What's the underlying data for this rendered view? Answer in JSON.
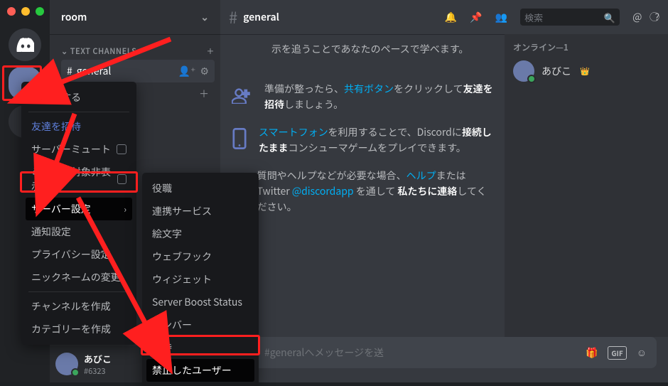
{
  "server": {
    "name": "room"
  },
  "channels": {
    "group_label": "TEXT CHANNELS",
    "items": [
      {
        "name": "general"
      }
    ]
  },
  "user_panel": {
    "name": "あびこ",
    "tag": "#6323"
  },
  "topbar": {
    "channel": "general",
    "search_placeholder": "検索"
  },
  "messages": {
    "m0": {
      "prefix": "示を追うことであなたのペースで学べます。"
    },
    "m1": {
      "prefix": "準備が整ったら、",
      "link": "共有ボタン",
      "suffix_bold": "友達を招待",
      "mid": "をクリックして",
      "tail": "しましょう。"
    },
    "m2": {
      "link": "スマートフォン",
      "mid": "を利用することで、Discordに",
      "bold": "接続したまま",
      "tail": "コンシューマゲームをプレイできます。"
    },
    "m3": {
      "pre": "質問やヘルプなどが必要な場合、",
      "link1": "ヘルプ",
      "mid": "または Twitter ",
      "link2": "@discordapp",
      "post": " を通して ",
      "bold": "私たちに連絡",
      "tail": "してください。"
    }
  },
  "composer": {
    "placeholder": "#generalへメッセージを送"
  },
  "members": {
    "header": "オンライン—1",
    "m0": "あびこ"
  },
  "context_menu": {
    "mark_read": "既読にする",
    "invite": "友達を招待",
    "mute_server": "サーバーミュート",
    "hide_muted": "ミュート対象非表示",
    "server_settings": "サーバー設定",
    "notif": "通知設定",
    "privacy": "プライバシー設定",
    "nickname": "ニックネームの変更",
    "create_channel": "チャンネルを作成",
    "create_category": "カテゴリーを作成"
  },
  "submenu": {
    "roles": "役職",
    "integrations": "連携サービス",
    "emoji": "絵文字",
    "webhooks": "ウェブフック",
    "widget": "ウィジェット",
    "boost": "Server Boost Status",
    "members": "メンバー",
    "invites": "招待",
    "banned": "禁止したユーザー"
  }
}
